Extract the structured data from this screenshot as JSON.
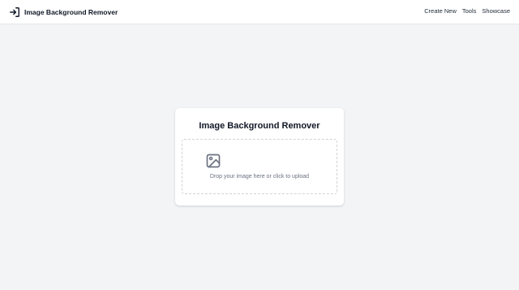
{
  "header": {
    "brand_icon": "sign-in-arrow-icon",
    "brand_title": "Image Background Remover",
    "nav": [
      {
        "label": "Create New"
      },
      {
        "label": "Tools"
      },
      {
        "label": "Showcase"
      }
    ]
  },
  "main": {
    "card_title": "Image Background Remover",
    "dropzone": {
      "icon": "image-icon",
      "text": "Drop your image here or click to upload"
    }
  },
  "colors": {
    "page_background": "#f3f4f6",
    "header_background": "#ffffff",
    "card_background": "#ffffff",
    "text_primary": "#111827",
    "text_muted": "#6b7280",
    "dropzone_border": "#cfd3d9"
  }
}
